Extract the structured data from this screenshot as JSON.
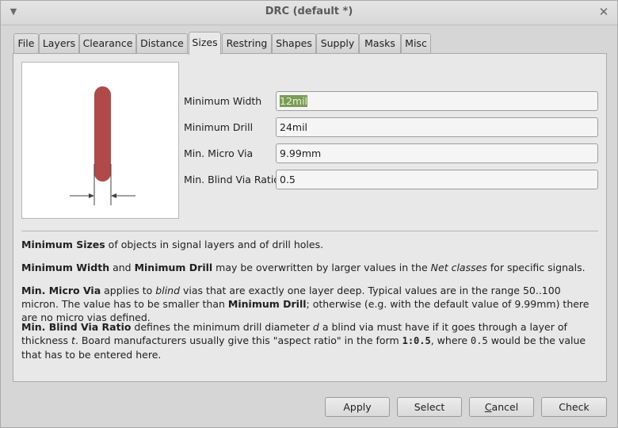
{
  "window": {
    "title": "DRC (default *)"
  },
  "tabs": [
    {
      "label": "File"
    },
    {
      "label": "Layers"
    },
    {
      "label": "Clearance"
    },
    {
      "label": "Distance"
    },
    {
      "label": "Sizes",
      "active": true
    },
    {
      "label": "Restring"
    },
    {
      "label": "Shapes"
    },
    {
      "label": "Supply"
    },
    {
      "label": "Masks"
    },
    {
      "label": "Misc"
    }
  ],
  "fields": {
    "min_width": {
      "label": "Minimum Width",
      "value": "12mil",
      "selected": true
    },
    "min_drill": {
      "label": "Minimum Drill",
      "value": "24mil"
    },
    "min_micro_via": {
      "label": "Min. Micro Via",
      "value": "9.99mm"
    },
    "min_blind_via_ratio": {
      "label": "Min. Blind Via Ratio",
      "value": "0.5"
    }
  },
  "help": {
    "p1_bold": "Minimum Sizes",
    "p1_rest": " of objects in signal layers and of drill holes.",
    "p2_bold1": "Minimum Width",
    "p2_and": " and ",
    "p2_bold2": "Minimum Drill",
    "p2_mid": " may be overwritten by larger values in the ",
    "p2_ital": "Net classes",
    "p2_end": " for specific signals.",
    "p3_bold": "Min. Micro Via",
    "p3_a": " applies to ",
    "p3_ital": "blind",
    "p3_b": " vias that are exactly one layer deep. Typical values are in the range 50..100 micron. The value has to be smaller than ",
    "p3_bold2": "Minimum Drill",
    "p3_c": "; otherwise (e.g. with the default value of 9.99mm) there are no micro vias defined.",
    "p4_bold": "Min. Blind Via Ratio",
    "p4_a": " defines the minimum drill diameter ",
    "p4_d": "d",
    "p4_b": " a blind via must have if it goes through a layer of thickness ",
    "p4_t": "t",
    "p4_c": ". Board manufacturers usually give this \"aspect ratio\" in the form ",
    "p4_code1": "1:0.5",
    "p4_d2": ", where ",
    "p4_code2": "0.5",
    "p4_e": " would be the value that has to be entered here."
  },
  "buttons": {
    "apply": "Apply",
    "select": "Select",
    "cancel_u": "C",
    "cancel_rest": "ancel",
    "check": "Check"
  },
  "colors": {
    "trace": "#b04a4a",
    "selection": "#7b9b5a"
  },
  "icons": {
    "window_menu": "triangle-down",
    "close": "x"
  }
}
